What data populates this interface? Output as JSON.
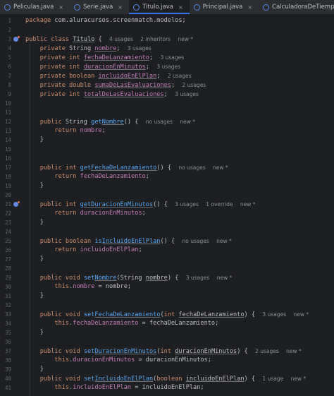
{
  "tabs": [
    {
      "label": "Peliculas.java",
      "active": false
    },
    {
      "label": "Serie.java",
      "active": false
    },
    {
      "label": "Titulo.java",
      "active": true
    },
    {
      "label": "Principal.java",
      "active": false
    },
    {
      "label": "CalculadoraDeTiempo.java",
      "active": false
    }
  ],
  "close_glyph": "×",
  "code": {
    "package": "com.aluracursos.screenmatch.modelos",
    "class_name": "Titulo",
    "usages": {
      "class": "4 usages",
      "inheritors": "2 inheritors",
      "new": "new *",
      "nombre": "3 usages",
      "fecha": "3 usages",
      "duracion": "3 usages",
      "incluido": "2 usages",
      "suma": "2 usages",
      "total": "3 usages",
      "getNombre": "no usages",
      "getFecha": "no usages",
      "getDuracion": "3 usages",
      "override": "1 override",
      "isIncluido": "no usages",
      "setNombre": "3 usages",
      "setFecha": "3 usages",
      "setDuracion": "2 usages",
      "setIncluido": "1 usage"
    }
  },
  "colors": {
    "background": "#1e1f22",
    "keyword": "#cf8e6d",
    "field": "#c77dbb",
    "method": "#56a8f5",
    "accent": "#3574f0"
  }
}
